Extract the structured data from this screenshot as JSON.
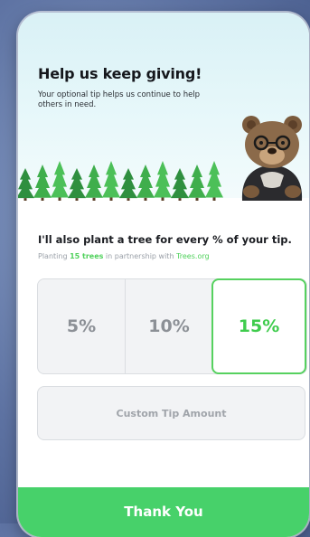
{
  "header": {
    "title": "Help us keep giving!",
    "subtitle": "Your optional tip helps us continue to help others in need."
  },
  "plant": {
    "headline": "I'll also plant a tree for every % of your tip.",
    "prefix": "Planting ",
    "tree_count": "15 trees",
    "middle": " in partnership with ",
    "partner": "Trees.org"
  },
  "tip_options": [
    {
      "label": "5%",
      "selected": false
    },
    {
      "label": "10%",
      "selected": false
    },
    {
      "label": "15%",
      "selected": true
    }
  ],
  "custom_tip": {
    "label": "Custom Tip Amount"
  },
  "submit": {
    "label": "Thank You"
  },
  "colors": {
    "accent_green": "#47d16a",
    "tree_green": "#3fae4c",
    "bear_brown": "#8b6a4a"
  },
  "icons": {
    "illustration_trees": "tree-row-illustration",
    "illustration_bear": "bear-mascot-illustration"
  }
}
